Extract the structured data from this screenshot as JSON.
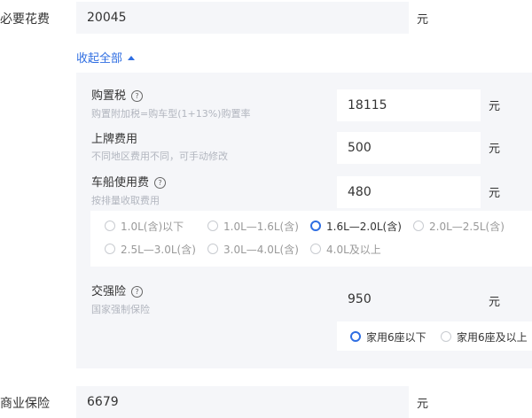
{
  "necessary_cost": {
    "label": "必要花费",
    "value": "20045",
    "unit": "元"
  },
  "toggle": {
    "label": "收起全部",
    "icon": "caret-up-icon"
  },
  "purchase_tax": {
    "title": "购置税",
    "help_icon": "question-circle-icon",
    "sub": "购置附加税=购车型(1+13%)购置率",
    "value": "18115",
    "unit": "元"
  },
  "license_fee": {
    "title": "上牌费用",
    "sub": "不同地区费用不同，可手动修改",
    "value": "500",
    "unit": "元"
  },
  "vehicle_tax": {
    "title": "车船使用费",
    "help_icon": "question-circle-icon",
    "sub": "按排量收取费用",
    "value": "480",
    "unit": "元",
    "options": [
      {
        "label": "1.0L(含)以下",
        "selected": false
      },
      {
        "label": "1.0L—1.6L(含)",
        "selected": false
      },
      {
        "label": "1.6L—2.0L(含)",
        "selected": true
      },
      {
        "label": "2.0L—2.5L(含)",
        "selected": false
      },
      {
        "label": "2.5L—3.0L(含)",
        "selected": false
      },
      {
        "label": "3.0L—4.0L(含)",
        "selected": false
      },
      {
        "label": "4.0L及以上",
        "selected": false
      }
    ]
  },
  "compulsory_insurance": {
    "title": "交强险",
    "help_icon": "question-circle-icon",
    "sub": "国家强制保险",
    "value": "950",
    "unit": "元",
    "options": [
      {
        "label": "家用6座以下",
        "selected": true
      },
      {
        "label": "家用6座及以上",
        "selected": false
      }
    ]
  },
  "commercial_insurance": {
    "label": "商业保险",
    "value": "6679",
    "unit": "元"
  },
  "colors": {
    "accent": "#2f6ee2",
    "panel_bg": "#f5f6f9",
    "sub_text": "#b2b6bf"
  }
}
